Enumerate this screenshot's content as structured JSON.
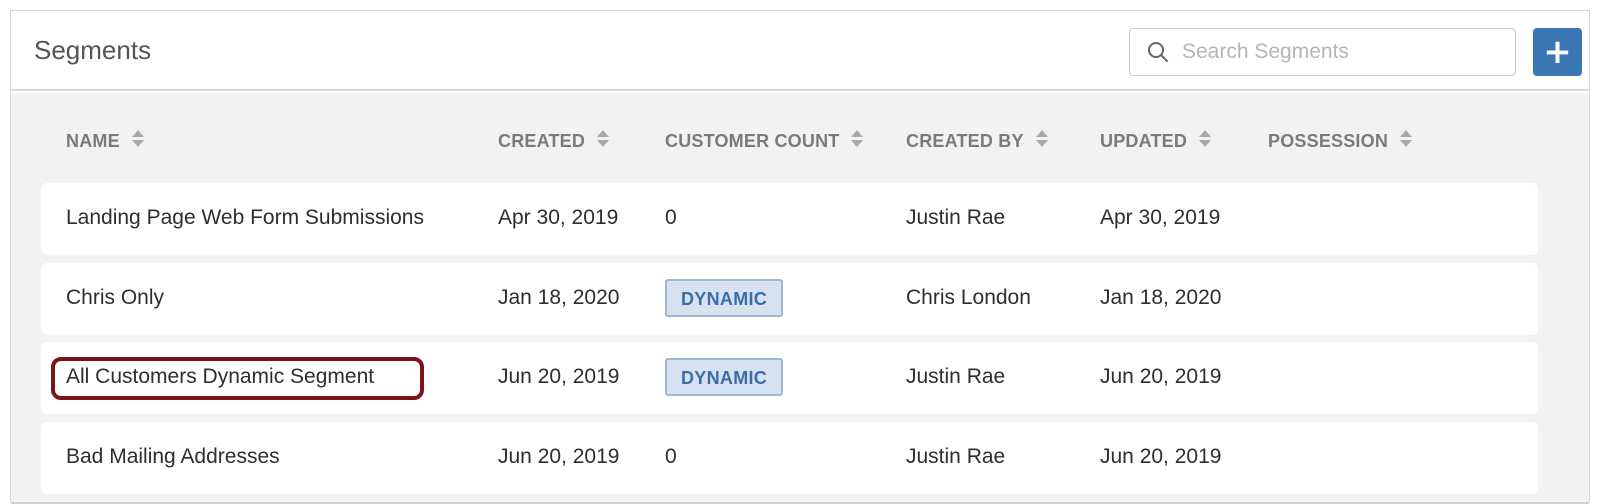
{
  "header": {
    "title": "Segments",
    "search_placeholder": "Search Segments",
    "add_label": "+"
  },
  "columns": [
    "NAME",
    "CREATED",
    "CUSTOMER COUNT",
    "CREATED BY",
    "UPDATED",
    "POSSESSION"
  ],
  "rows": [
    {
      "name": "Landing Page Web Form Submissions",
      "created": "Apr 30, 2019",
      "customer_count": "0",
      "created_by": "Justin Rae",
      "updated": "Apr 30, 2019",
      "possession": ""
    },
    {
      "name": "Chris Only",
      "created": "Jan 18, 2020",
      "customer_count": "DYNAMIC",
      "created_by": "Chris London",
      "updated": "Jan 18, 2020",
      "possession": ""
    },
    {
      "name": "All Customers Dynamic Segment",
      "created": "Jun 20, 2019",
      "customer_count": "DYNAMIC",
      "created_by": "Justin Rae",
      "updated": "Jun 20, 2019",
      "possession": "",
      "highlighted": true
    },
    {
      "name": "Bad Mailing Addresses",
      "created": "Jun 20, 2019",
      "customer_count": "0",
      "created_by": "Justin Rae",
      "updated": "Jun 20, 2019",
      "possession": ""
    }
  ],
  "colors": {
    "accent": "#3a76b4",
    "badge_text": "#3b6ea8",
    "badge_bg": "#d6e2ef",
    "highlight": "#7e1219"
  },
  "icons": {
    "search": "search-icon",
    "add": "plus-icon",
    "sort": "sort-icon"
  }
}
